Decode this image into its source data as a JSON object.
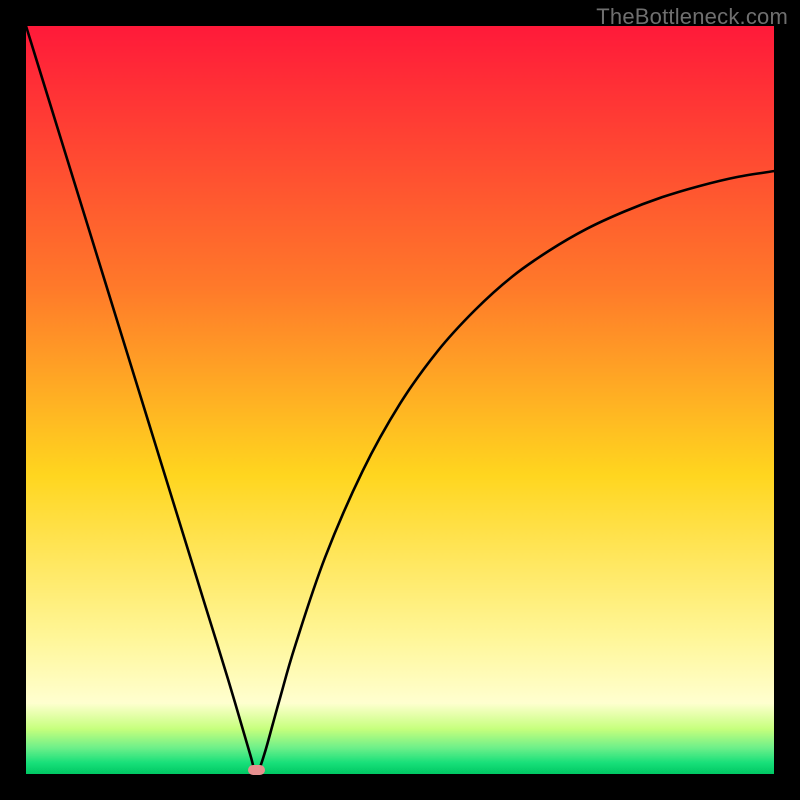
{
  "watermark": {
    "text": "TheBottleneck.com"
  },
  "chart_data": {
    "type": "line",
    "title": "",
    "xlabel": "",
    "ylabel": "",
    "xlim": [
      0,
      100
    ],
    "ylim": [
      0,
      100
    ],
    "grid": false,
    "legend": false,
    "background_gradient_stops": [
      {
        "pos": 0.0,
        "color": "#ff1a3a"
      },
      {
        "pos": 0.35,
        "color": "#ff7a2a"
      },
      {
        "pos": 0.6,
        "color": "#ffd61f"
      },
      {
        "pos": 0.82,
        "color": "#fff79a"
      },
      {
        "pos": 0.905,
        "color": "#ffffd0"
      },
      {
        "pos": 0.94,
        "color": "#c6ff7d"
      },
      {
        "pos": 0.965,
        "color": "#6ef08a"
      },
      {
        "pos": 0.985,
        "color": "#18e07a"
      },
      {
        "pos": 1.0,
        "color": "#00c864"
      }
    ],
    "series": [
      {
        "name": "bottleneck-curve",
        "x": [
          0,
          3,
          6,
          9,
          12,
          15,
          18,
          21,
          24,
          27,
          30,
          30.5,
          31.1,
          32,
          33,
          34,
          36,
          40,
          45,
          50,
          55,
          60,
          65,
          70,
          75,
          80,
          85,
          90,
          95,
          100
        ],
        "y": [
          100,
          90.3,
          80.6,
          70.9,
          61.2,
          51.5,
          41.8,
          32.1,
          22.4,
          12.7,
          2.5,
          0.5,
          0.5,
          3.1,
          6.7,
          10.3,
          17.2,
          29.0,
          40.5,
          49.5,
          56.5,
          62.0,
          66.5,
          70.0,
          72.9,
          75.2,
          77.1,
          78.6,
          79.8,
          80.6
        ]
      }
    ],
    "marker": {
      "x": 30.8,
      "y": 0.5,
      "width_pct": 2.2,
      "height_pct": 1.3,
      "color": "#e78f8f"
    }
  }
}
